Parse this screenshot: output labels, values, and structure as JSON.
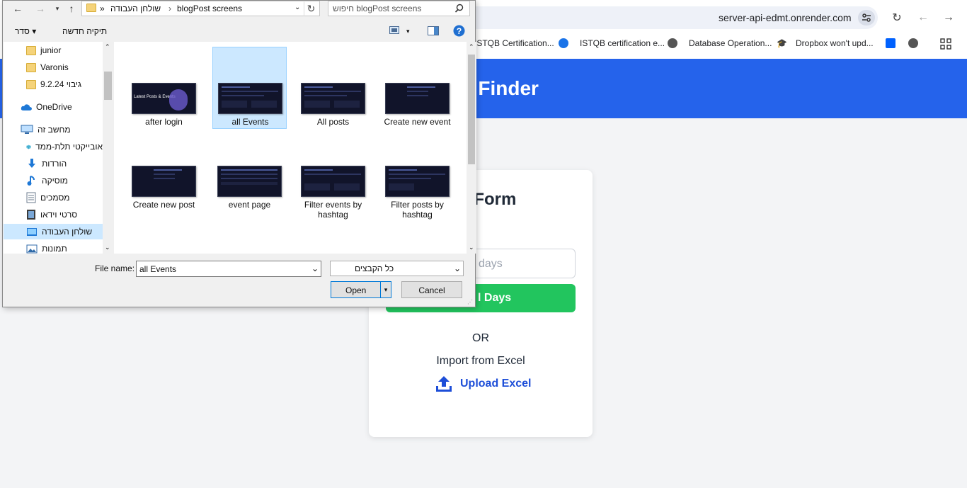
{
  "browser": {
    "url": "server-api-edmt.onrender.com",
    "bookmarks": [
      {
        "label": "ISTQB Certification..."
      },
      {
        "label": "ISTQB certification e..."
      },
      {
        "label": "Database Operation..."
      },
      {
        "label": "Dropbox won't upd..."
      }
    ]
  },
  "site": {
    "title": "ents Finder",
    "form_title": "vents Form",
    "days_placeholder": "days",
    "days_button": "l Days",
    "or_text": "OR",
    "import_text": "Import from Excel",
    "upload_label": "Upload Excel"
  },
  "dialog": {
    "path_root": "שולחן העבודה",
    "path_folder": "blogPost screens",
    "path_sep": "»",
    "search_placeholder": "חיפוש blogPost screens",
    "toolbar": {
      "organize": "סדר",
      "new_folder": "תיקיה חדשה"
    },
    "nav_items": [
      {
        "label": "junior",
        "icon": "folder-icon"
      },
      {
        "label": "Varonis",
        "icon": "folder-icon"
      },
      {
        "label": "גיבוי 9.2.24",
        "icon": "folder-icon"
      },
      {
        "label": "OneDrive",
        "icon": "cloud-icon"
      },
      {
        "label": "מחשב זה",
        "icon": "computer-icon"
      },
      {
        "label": "אובייקטי תלת-ממד",
        "icon": "cube-icon"
      },
      {
        "label": "הורדות",
        "icon": "download-icon"
      },
      {
        "label": "מוסיקה",
        "icon": "music-icon"
      },
      {
        "label": "מסמכים",
        "icon": "document-icon"
      },
      {
        "label": "סרטי וידאו",
        "icon": "video-icon"
      },
      {
        "label": "שולחן העבודה",
        "icon": "desktop-icon"
      },
      {
        "label": "תמונות",
        "icon": "pictures-icon"
      }
    ],
    "files": [
      {
        "name": "after login",
        "thumb_caption": "Latest Posts & Events"
      },
      {
        "name": "all Events"
      },
      {
        "name": "All posts"
      },
      {
        "name": "Create new event"
      },
      {
        "name": "Create new post"
      },
      {
        "name": "event page"
      },
      {
        "name": "Filter events by hashtag"
      },
      {
        "name": "Filter posts by hashtag"
      }
    ],
    "file_name_label": "File name:",
    "file_name_value": "all Events",
    "file_type": "כל הקבצים",
    "open_label": "Open",
    "cancel_label": "Cancel"
  },
  "colors": {
    "accent": "#2563eb",
    "green": "#22c55e",
    "selection": "#cce8ff"
  }
}
